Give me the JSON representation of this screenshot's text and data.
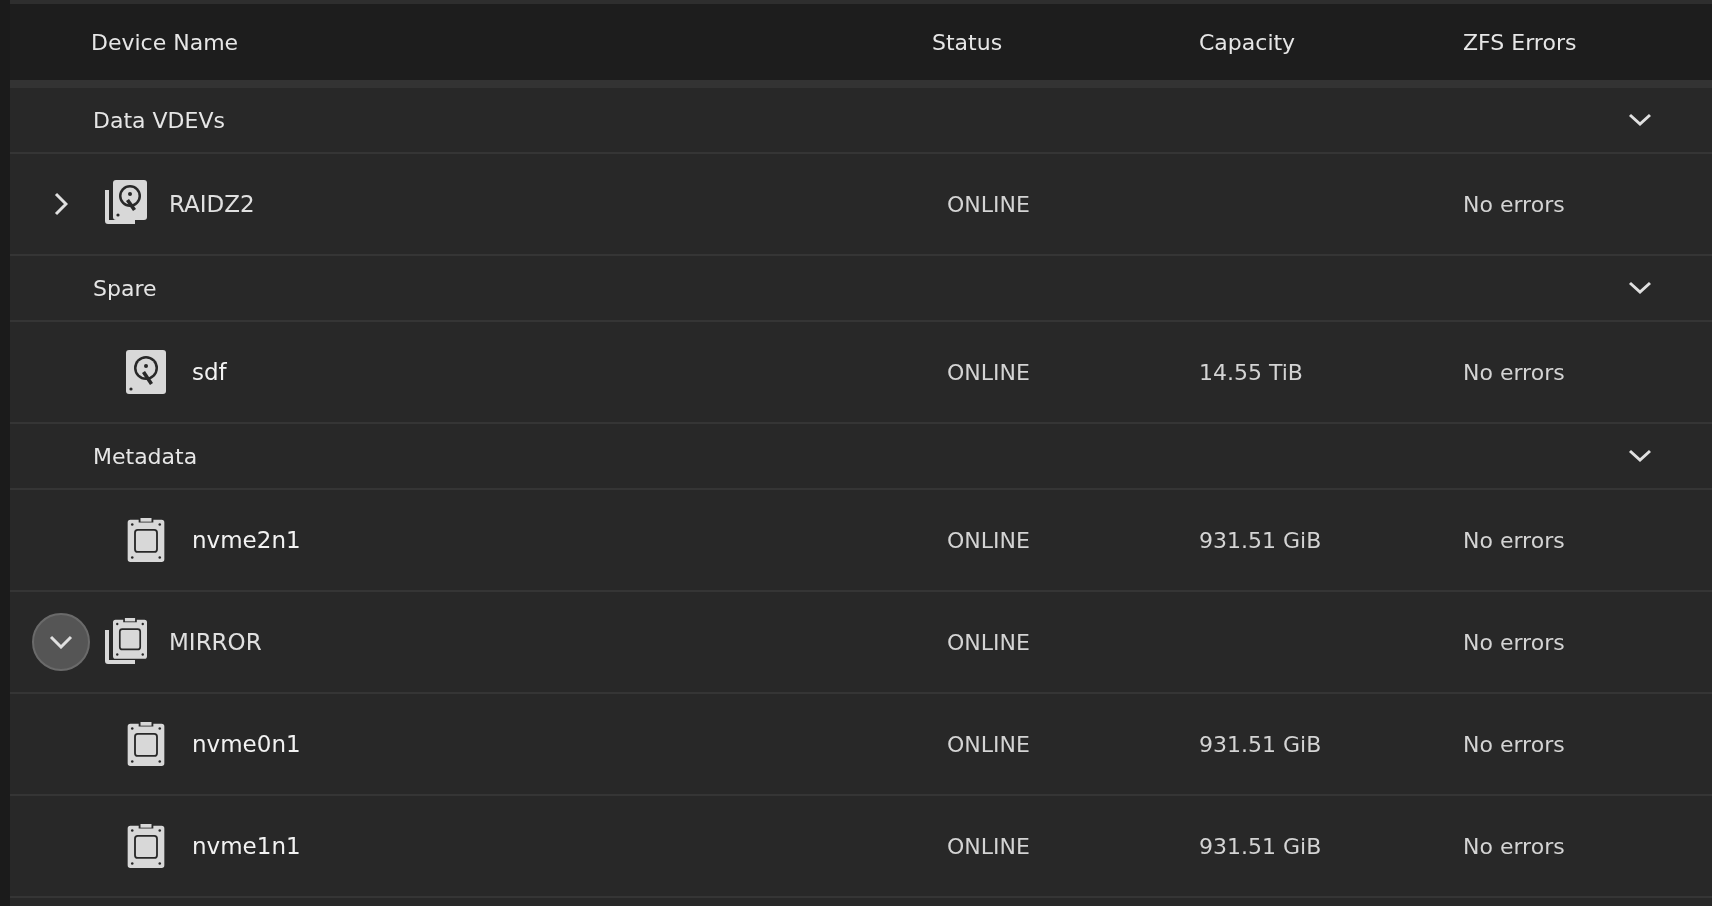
{
  "columns": [
    "Device Name",
    "Status",
    "Capacity",
    "ZFS Errors"
  ],
  "sections": [
    {
      "title": "Data VDEVs",
      "expanded": true,
      "rows": [
        {
          "kind": "hddgroup",
          "name": "RAIDZ2",
          "status": "ONLINE",
          "errors": "No errors",
          "expanded": false,
          "focused": false
        }
      ]
    },
    {
      "title": "Spare",
      "expanded": true,
      "rows": [
        {
          "kind": "hdd",
          "name": "sdf",
          "status": "ONLINE",
          "capacity": "14.55 TiB",
          "errors": "No errors"
        }
      ]
    },
    {
      "title": "Metadata",
      "expanded": true,
      "rows": [
        {
          "kind": "ssd",
          "name": "nvme2n1",
          "status": "ONLINE",
          "capacity": "931.51 GiB",
          "errors": "No errors"
        },
        {
          "kind": "ssdgroup",
          "name": "MIRROR",
          "status": "ONLINE",
          "errors": "No errors",
          "expanded": true,
          "focused": true,
          "children": [
            {
              "kind": "ssd",
              "name": "nvme0n1",
              "status": "ONLINE",
              "capacity": "931.51 GiB",
              "errors": "No errors"
            },
            {
              "kind": "ssd",
              "name": "nvme1n1",
              "status": "ONLINE",
              "capacity": "931.51 GiB",
              "errors": "No errors"
            }
          ]
        }
      ]
    }
  ]
}
